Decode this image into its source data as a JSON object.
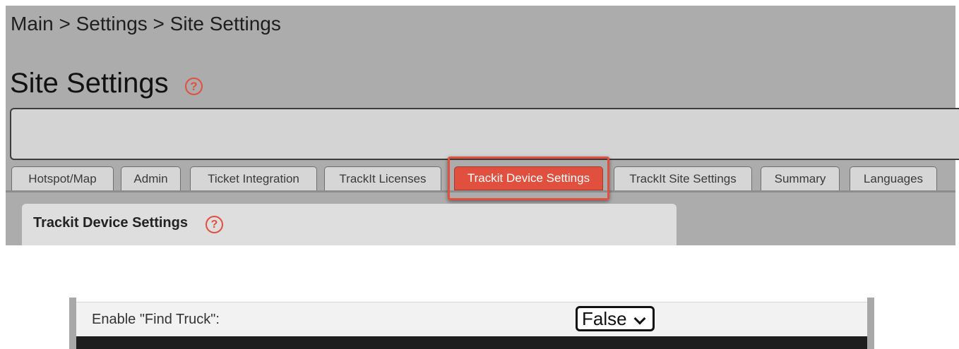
{
  "breadcrumb": "Main > Settings > Site Settings",
  "page": {
    "title": "Site Settings",
    "help_glyph": "?"
  },
  "tabs": [
    {
      "label": "Hotspot/Map"
    },
    {
      "label": "Admin"
    },
    {
      "label": "Ticket Integration"
    },
    {
      "label": "TrackIt Licenses"
    },
    {
      "label": "Trackit Device Settings",
      "active": true
    },
    {
      "label": "TrackIt Site Settings"
    },
    {
      "label": "Summary"
    },
    {
      "label": "Languages"
    }
  ],
  "section": {
    "title": "Trackit Device Settings",
    "help_glyph": "?"
  },
  "setting": {
    "label": "Enable \"Find Truck\":",
    "value": "False"
  },
  "colors": {
    "accent": "#e1503f",
    "panel_bg": "#acacac"
  }
}
